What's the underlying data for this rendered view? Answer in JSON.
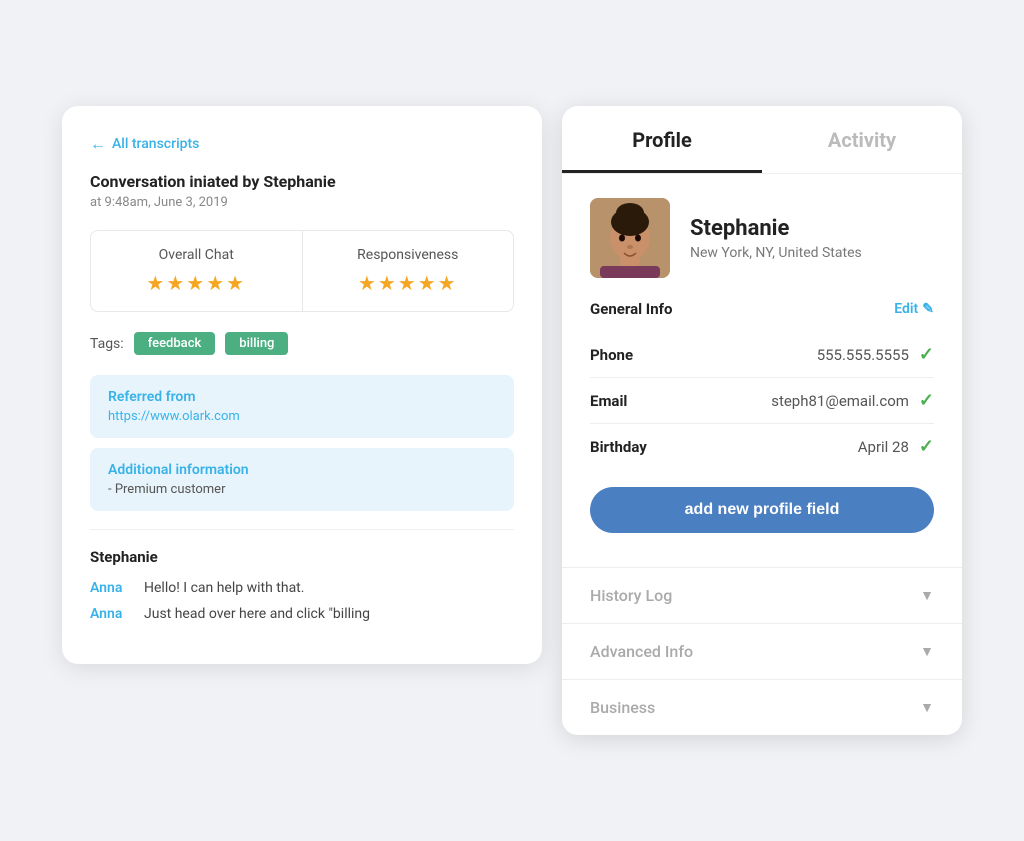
{
  "left": {
    "back_label": "All transcripts",
    "conversation_title": "Conversation iniated by Stephanie",
    "conversation_subtitle": "at 9:48am, June 3, 2019",
    "ratings": [
      {
        "label": "Overall Chat",
        "stars": "★★★★★"
      },
      {
        "label": "Responsiveness",
        "stars": "★★★★★"
      }
    ],
    "tags_label": "Tags:",
    "tags": [
      "feedback",
      "billing"
    ],
    "info_blocks": [
      {
        "title": "Referred from",
        "text": "https://www.olark.com",
        "is_link": true
      },
      {
        "title": "Additional information",
        "text": "- Premium customer",
        "is_link": false
      }
    ],
    "chat_author": "Stephanie",
    "chat_lines": [
      {
        "name": "Anna",
        "text": "Hello! I can help with that."
      },
      {
        "name": "Anna",
        "text": "Just head over here and click \"billing"
      }
    ]
  },
  "right": {
    "tabs": [
      {
        "label": "Profile",
        "active": true
      },
      {
        "label": "Activity",
        "active": false
      }
    ],
    "profile": {
      "name": "Stephanie",
      "location": "New York, NY, United States",
      "general_info_label": "General Info",
      "edit_label": "Edit",
      "fields": [
        {
          "label": "Phone",
          "value": "555.555.5555",
          "verified": true
        },
        {
          "label": "Email",
          "value": "steph81@email.com",
          "verified": true
        },
        {
          "label": "Birthday",
          "value": "April 28",
          "verified": true
        }
      ],
      "add_field_btn": "add new profile field"
    },
    "accordions": [
      {
        "label": "History Log"
      },
      {
        "label": "Advanced Info"
      },
      {
        "label": "Business"
      }
    ]
  },
  "icons": {
    "back_arrow": "←",
    "edit_pencil": "✎",
    "check": "✓",
    "chevron_down": "▼"
  }
}
